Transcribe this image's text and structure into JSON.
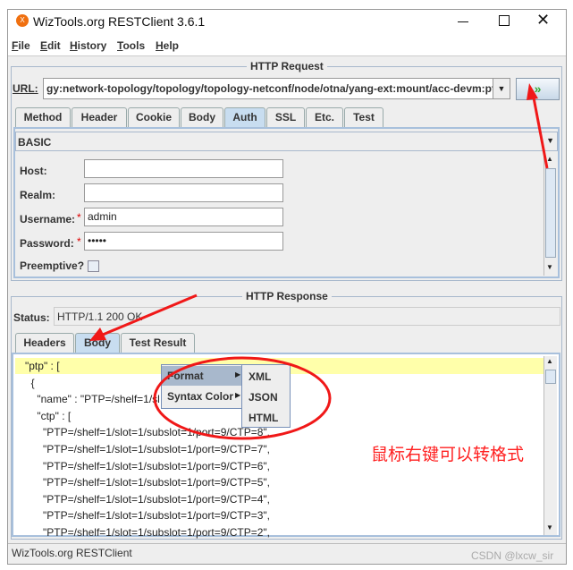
{
  "window": {
    "title": "WizTools.org RESTClient 3.6.1",
    "icon": "wiztools-logo-icon"
  },
  "menu": [
    "File",
    "Edit",
    "History",
    "Tools",
    "Help"
  ],
  "request": {
    "legend": "HTTP Request",
    "url_label": "URL:",
    "url_value": "gy:network-topology/topology/topology-netconf/node/otna/yang-ext:mount/acc-devm:ptps",
    "tabs": [
      "Method",
      "Header",
      "Cookie",
      "Body",
      "Auth",
      "SSL",
      "Etc.",
      "Test"
    ],
    "selected_tab": "Auth",
    "auth": {
      "type": "BASIC",
      "host_label": "Host:",
      "host": "",
      "realm_label": "Realm:",
      "realm": "",
      "username_label": "Username:",
      "username": "admin",
      "password_label": "Password:",
      "password": "•••••",
      "required_mark": "*",
      "preemptive_label": "Preemptive?",
      "preemptive": false
    }
  },
  "response": {
    "legend": "HTTP Response",
    "status_label": "Status:",
    "status": "HTTP/1.1 200 OK",
    "tabs": [
      "Headers",
      "Body",
      "Test Result"
    ],
    "selected_tab": "Body",
    "body_lines": [
      "\"ptp\" : [",
      "  {",
      "    \"name\" : \"PTP=/shelf=1/sl",
      "    \"ctp\" : [",
      "      \"PTP=/shelf=1/slot=1/subslot=1/port=9/CTP=8\",",
      "      \"PTP=/shelf=1/slot=1/subslot=1/port=9/CTP=7\",",
      "      \"PTP=/shelf=1/slot=1/subslot=1/port=9/CTP=6\",",
      "      \"PTP=/shelf=1/slot=1/subslot=1/port=9/CTP=5\",",
      "      \"PTP=/shelf=1/slot=1/subslot=1/port=9/CTP=4\",",
      "      \"PTP=/shelf=1/slot=1/subslot=1/port=9/CTP=3\",",
      "      \"PTP=/shelf=1/slot=1/subslot=1/port=9/CTP=2\","
    ]
  },
  "context_menu": {
    "items": [
      "Format",
      "Syntax Color"
    ],
    "submenu": [
      "XML",
      "JSON",
      "HTML"
    ]
  },
  "annotation": {
    "text": "鼠标右键可以转格式",
    "color": "#ff2020"
  },
  "statusbar": "WizTools.org RESTClient",
  "watermark": "CSDN @lxcw_sir"
}
